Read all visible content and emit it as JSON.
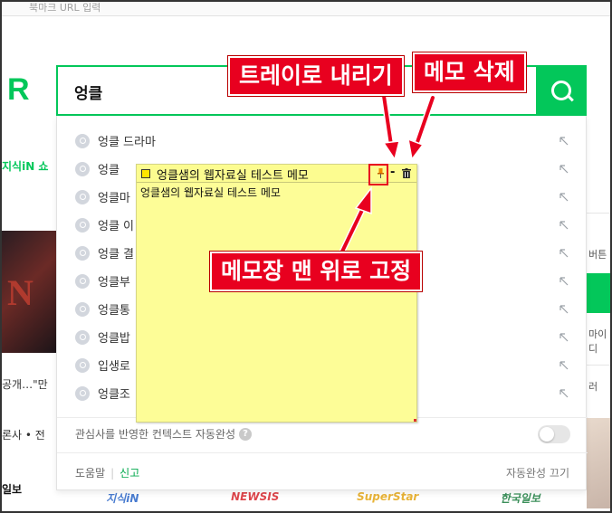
{
  "top_bar": {
    "text": "북마크 URL 입력"
  },
  "logo": {
    "text": "R"
  },
  "search": {
    "value": "엉클"
  },
  "suggestions": [
    "엉클 드라마",
    "엉클",
    "엉클마",
    "엉클 이",
    "엉클 결",
    "엉클부",
    "엉클통",
    "엉클밥",
    "입생로",
    "엉클조"
  ],
  "context_toggle": {
    "label": "관심사를 반영한 컨텍스트 자동완성",
    "help": "?",
    "enabled": false
  },
  "footer": {
    "help": "도움말",
    "separator": "|",
    "report": "신고",
    "autocomplete_off": "자동완성 끄기"
  },
  "memo": {
    "title": "엉클샘의 웹자료실 테스트 메모",
    "minimize": "-",
    "body": "엉클샘의 웹자료실 테스트 메모"
  },
  "annotations": {
    "tray": "트레이로 내리기",
    "delete": "메모 삭제",
    "pin": "메모장 맨 위로 고정"
  },
  "background": {
    "jisik": "지식iN  쇼",
    "gong": "공개…\"만",
    "ronsa": "론사 • 전",
    "ilbo": "일보",
    "right_texts": [
      "버튼",
      "마이디",
      "러"
    ],
    "bottom_logos": [
      "지식iN",
      "NEWSIS",
      "SuperStar",
      "한국일보"
    ]
  },
  "colors": {
    "accent": "#03c75a",
    "annotation_red": "#e8001f",
    "memo_yellow": "#fdfd97"
  }
}
